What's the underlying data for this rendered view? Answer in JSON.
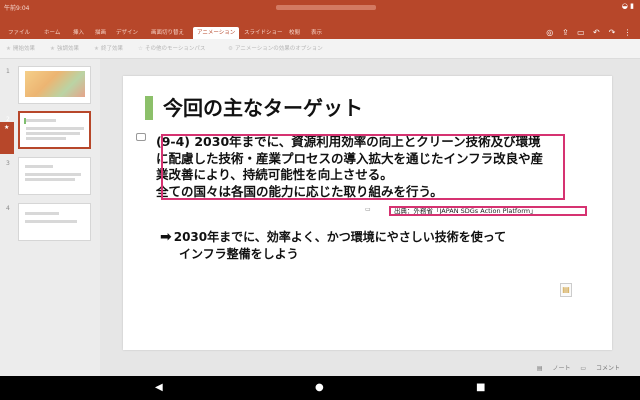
{
  "status": {
    "time": "午前9:04"
  },
  "ribbon": {
    "tabs": [
      "ファイル",
      "ホーム",
      "挿入",
      "描画",
      "デザイン",
      "画面切り替え",
      "アニメーション",
      "スライドショー",
      "校閲",
      "表示"
    ],
    "active_tab": "アニメーション"
  },
  "commands": [
    {
      "icon": "★",
      "label": "開始効果"
    },
    {
      "icon": "★",
      "label": "強調効果"
    },
    {
      "icon": "★",
      "label": "終了効果"
    },
    {
      "icon": "☆",
      "label": "その他のモーションパス"
    },
    {
      "icon": "⚙",
      "label": "アニメーションの効果のオプション"
    }
  ],
  "thumbnails": [
    {
      "number": "1"
    },
    {
      "number": "2"
    },
    {
      "number": "3"
    },
    {
      "number": "4"
    }
  ],
  "slide": {
    "title": "今回の主なターゲット",
    "body_lines": [
      "(9-4) 2030年までに、資源利用効率の向上とクリーン技術及び環境",
      "に配慮した技術・産業プロセスの導入拡大を通じたインフラ改良や産",
      "業改善により、持続可能性を向上させる。",
      "全ての国々は各国の能力に応じた取り組みを行う。"
    ],
    "source": "出典：外務省「JAPAN SDGs Action Platform」",
    "arrow_glyph": "➡",
    "point_line1": "2030年までに、効率よく、かつ環境にやさしい技術を使って",
    "point_line2": "インフラ整備をしよう"
  },
  "bottom": {
    "notes_label": "ノート",
    "comments_label": "コメント"
  },
  "colors": {
    "brand": "#b7472a",
    "highlight": "#d63271",
    "accent": "#8cc06a"
  }
}
